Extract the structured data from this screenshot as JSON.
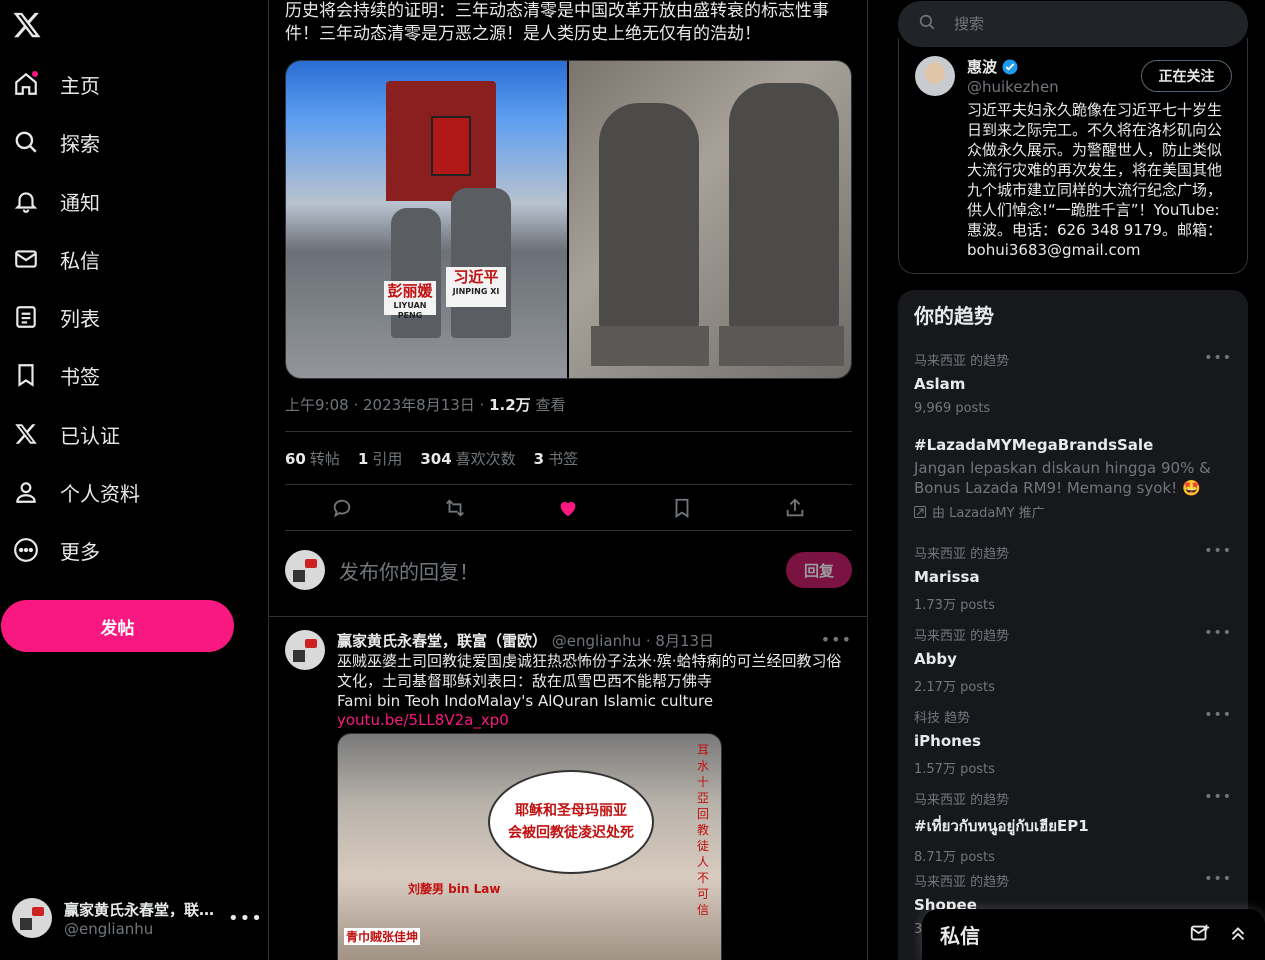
{
  "nav": {
    "home": "主页",
    "explore": "探索",
    "notifications": "通知",
    "messages": "私信",
    "lists": "列表",
    "bookmarks": "书签",
    "verified": "已认证",
    "profile": "个人资料",
    "more": "更多",
    "post_button": "发帖"
  },
  "account": {
    "name": "赢家黄氏永春堂，联…",
    "handle": "@englianhu"
  },
  "tweet": {
    "text": "历史将会持续的证明：三年动态清零是中国改革开放由盛转衰的标志性事件！三年动态清零是万恶之源！是人类历史上绝无仅有的浩劫！",
    "photo_sign_left": "彭丽媛",
    "photo_sign_left_sub": "LIYUAN PENG",
    "photo_sign_right": "习近平",
    "photo_sign_right_sub": "JINPING XI",
    "time": "上午9:08 · 2023年8月13日 · ",
    "views_count": "1.2万",
    "views_label": " 查看",
    "stats": {
      "reposts_count": "60",
      "reposts_label": "转帖",
      "quotes_count": "1",
      "quotes_label": "引用",
      "likes_count": "304",
      "likes_label": "喜欢次数",
      "bookmarks_count": "3",
      "bookmarks_label": "书签"
    }
  },
  "reply_box": {
    "placeholder": "发布你的回复！",
    "button": "回复"
  },
  "reply_tweet": {
    "name": "赢家黄氏永春堂，联富（雷欧）",
    "handle": "@englianhu",
    "date": "· 8月13日",
    "text": "巫贼巫婆土司回教徒爱国虔诚狂热恐怖份子法米·殡·蛤特痢的可兰经回教习俗文化，土司基督耶稣刘表曰：敌在瓜雪巴西不能帮万佛寺",
    "text_en": "Fami bin Teoh IndoMalay's AlQuran Islamic culture",
    "link": "youtu.be/5LL8V2a_xp0",
    "bubble_line1": "耶稣和圣母玛丽亚",
    "bubble_line2": "会被回教徒凌迟处死",
    "img_label1": "刘嫠男 bin Law",
    "img_label2": "青巾贼张佳坤",
    "img_vertical": "耳水十亞回教徒人不可信"
  },
  "search": {
    "placeholder": "搜索"
  },
  "profile_card": {
    "name": "惠波",
    "handle": "@huikezhen",
    "follow_button": "正在关注",
    "bio": "习近平夫妇永久跪像在习近平七十岁生日到来之际完工。不久将在洛杉矶向公众做永久展示。为警醒世人，防止类似大流行灾难的再次发生，将在美国其他九个城市建立同样的大流行纪念广场，供人们悼念!“一跪胜千言”！YouTube:惠波。电话：626 348 9179。邮箱：bohui3683@gmail.com"
  },
  "trends": {
    "title": "你的趋势",
    "items": [
      {
        "context": "马来西亚 的趋势",
        "name": "Aslam",
        "count": "9,969 posts"
      },
      {
        "context": "马来西亚 的趋势",
        "name": "Marissa",
        "count": "1.73万 posts"
      },
      {
        "context": "马来西亚 的趋势",
        "name": "Abby",
        "count": "2.17万 posts"
      },
      {
        "context": "科技 趋势",
        "name": "iPhones",
        "count": "1.57万 posts"
      },
      {
        "context": "马来西亚 的趋势",
        "name": "#เที่ยวกับหนูอยู่กับเฮียEP1",
        "count": "8.71万 posts"
      },
      {
        "context": "马来西亚 的趋势",
        "name": "Shopee",
        "count": "3"
      }
    ],
    "promoted": {
      "name": "#LazadaMYMegaBrandsSale",
      "desc": "Jangan lepaskan diskaun hingga 90% & Bonus Lazada RM9! Memang syok! 🤩",
      "by": "由 LazadaMY 推广"
    }
  },
  "dm": {
    "title": "私信"
  },
  "colors": {
    "accent": "#f91880",
    "verified": "#1d9bf0",
    "background": "#000000",
    "border": "#2f3336",
    "muted": "#71767b"
  }
}
